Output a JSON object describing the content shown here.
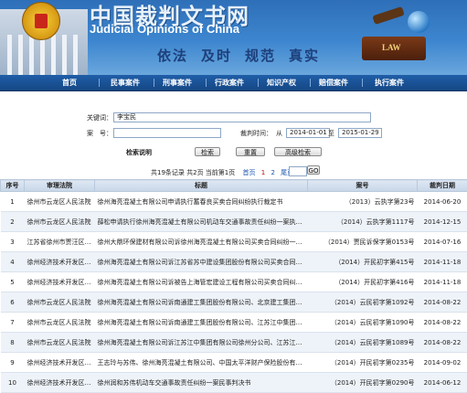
{
  "header": {
    "title_cn": "中国裁判文书网",
    "title_en": "Judicial Opinions of China",
    "slogans": [
      "依法",
      "及时",
      "规范",
      "真实"
    ],
    "book_label": "LAW"
  },
  "nav": {
    "items": [
      "首页",
      "民事案件",
      "刑事案件",
      "行政案件",
      "知识产权",
      "赔偿案件",
      "执行案件"
    ]
  },
  "search": {
    "keyword_label": "关键词：",
    "keyword_value": "李宝民",
    "case_no_label": "案　号：",
    "case_no_value": "",
    "date_label": "裁判时间：",
    "from_label": "从",
    "from_value": "2014-01-01",
    "to_label": "至",
    "to_value": "2015-01-29",
    "help_label": "检索说明",
    "search_button": "检索",
    "reset_button": "重置",
    "advanced_button": "高级检索"
  },
  "pager": {
    "summary": "共19条记录 共2页 当前第1页",
    "first": "首页",
    "pages": [
      "1",
      "2"
    ],
    "last": "尾页",
    "go_button": "GO",
    "page_input": ""
  },
  "table": {
    "headers": [
      "序号",
      "审理法院",
      "标题",
      "案号",
      "裁判日期"
    ],
    "rows": [
      {
        "no": "1",
        "court": "徐州市云龙区人民法院",
        "title": "徐州海亮混凝土有限公司申请执行蓄春良买卖合同纠纷执行裁定书",
        "case": "（2013）云执字第23号",
        "date": "2014-06-20"
      },
      {
        "no": "2",
        "court": "徐州市云龙区人民法院",
        "title": "薛松申请执行徐州海亮混凝土有限公司机动车交通事故责任纠纷一案执行裁定书",
        "case": "（2014）云执字第1117号",
        "date": "2014-12-15"
      },
      {
        "no": "3",
        "court": "江苏省徐州市贾汪区人…",
        "title": "徐州大鼎环保建材有限公司诉徐州海亮混凝土有限公司买卖合同纠纷一审案件裁定书",
        "case": "（2014）贾民诉保字第0153号",
        "date": "2014-07-16"
      },
      {
        "no": "4",
        "court": "徐州经济技术开发区人…",
        "title": "徐州海亮混凝土有限公司诉江苏省苏中建设集团股份有限公司买卖合同纠纷一…",
        "case": "（2014）开民初字第415号",
        "date": "2014-11-18"
      },
      {
        "no": "5",
        "court": "徐州经济技术开发区人…",
        "title": "徐州海亮混凝土有限公司诉被告上海管宏建设工程有限公司买卖合同纠纷一案…",
        "case": "（2014）开民初字第416号",
        "date": "2014-11-18"
      },
      {
        "no": "6",
        "court": "徐州市云龙区人民法院",
        "title": "徐州海亮混凝土有限公司诉南通建工集团股份有限公司、北京建工集团有限责任…",
        "case": "（2014）云民初字第1092号",
        "date": "2014-08-22"
      },
      {
        "no": "7",
        "court": "徐州市云龙区人民法院",
        "title": "徐州海亮混凝土有限公司诉南通建工集团股份有限公司、江苏江中集团有限公司…",
        "case": "（2014）云民初字第1090号",
        "date": "2014-08-22"
      },
      {
        "no": "8",
        "court": "徐州市云龙区人民法院",
        "title": "徐州海亮混凝土有限公司诉江苏江中集团有限公司徐州分公司、江苏江中集团…",
        "case": "（2014）云民初字第1089号",
        "date": "2014-08-22"
      },
      {
        "no": "9",
        "court": "徐州经济技术开发区人…",
        "title": "王志玲与苏伟、徐州海亮混凝土有限公司、中国太平洋财产保险股份有限公司…",
        "case": "（2014）开民初字第0235号",
        "date": "2014-09-02"
      },
      {
        "no": "10",
        "court": "徐州经济技术开发区人…",
        "title": "徐州润和苏伟机动车交通事故责任纠纷一案民事判决书",
        "case": "（2014）开民初字第0290号",
        "date": "2014-06-12"
      }
    ]
  }
}
